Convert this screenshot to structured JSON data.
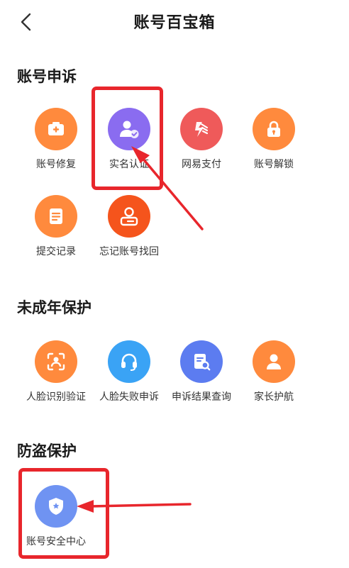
{
  "header": {
    "title": "账号百宝箱",
    "back_icon": "chevron-left-icon"
  },
  "colors": {
    "orange": "#ff8a3d",
    "purple": "#8a6cf0",
    "red": "#ef5a5a",
    "blue": "#3aa3f5",
    "indigo": "#5c7cf0",
    "shield_blue": "#6f93f2",
    "annotation_red": "#e8262c"
  },
  "sections": [
    {
      "title": "账号申诉",
      "items": [
        {
          "label": "账号修复",
          "icon": "camera-icon"
        },
        {
          "label": "实名认证",
          "icon": "user-verified-icon"
        },
        {
          "label": "网易支付",
          "icon": "payment-icon"
        },
        {
          "label": "账号解锁",
          "icon": "lock-icon"
        },
        {
          "label": "提交记录",
          "icon": "document-icon"
        },
        {
          "label": "忘记账号找回",
          "icon": "user-card-icon"
        }
      ]
    },
    {
      "title": "未成年保护",
      "items": [
        {
          "label": "人脸识别验证",
          "icon": "face-scan-icon"
        },
        {
          "label": "人脸失败申诉",
          "icon": "headset-icon"
        },
        {
          "label": "申诉结果查询",
          "icon": "document-search-icon"
        },
        {
          "label": "家长护航",
          "icon": "person-icon"
        }
      ]
    },
    {
      "title": "防盗保护",
      "items": [
        {
          "label": "账号安全中心",
          "icon": "shield-icon"
        }
      ]
    }
  ]
}
